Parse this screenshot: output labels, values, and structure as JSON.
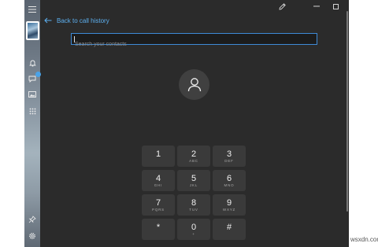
{
  "titlebar": {
    "pen_icon": "pen-icon",
    "minimize_icon": "minimize-icon",
    "maximize_icon": "maximize-icon",
    "close_icon": "close-icon"
  },
  "sidebar": {
    "items": [
      {
        "name": "hamburger-menu-icon"
      },
      {
        "name": "profile-avatar"
      },
      {
        "name": "bell-icon"
      },
      {
        "name": "messages-icon",
        "badge": true
      },
      {
        "name": "photos-icon"
      },
      {
        "name": "dialpad-icon"
      },
      {
        "name": "pin-icon"
      },
      {
        "name": "settings-gear-icon"
      }
    ]
  },
  "header": {
    "back_label": "Back to call history"
  },
  "search": {
    "placeholder": "Search your contacts",
    "value": ""
  },
  "dialpad": {
    "keys": [
      {
        "digit": "1",
        "letters": ""
      },
      {
        "digit": "2",
        "letters": "ABC"
      },
      {
        "digit": "3",
        "letters": "DEF"
      },
      {
        "digit": "4",
        "letters": "GHI"
      },
      {
        "digit": "5",
        "letters": "JKL"
      },
      {
        "digit": "6",
        "letters": "MNO"
      },
      {
        "digit": "7",
        "letters": "PQRS"
      },
      {
        "digit": "8",
        "letters": "TUV"
      },
      {
        "digit": "9",
        "letters": "WXYZ"
      },
      {
        "digit": "*",
        "letters": ""
      },
      {
        "digit": "0",
        "letters": "+"
      },
      {
        "digit": "#",
        "letters": ""
      }
    ]
  },
  "watermark": "wsxdn.com",
  "colors": {
    "accent": "#5db0f0",
    "background": "#2b2b2b",
    "key_bg": "#3a3a3a"
  }
}
